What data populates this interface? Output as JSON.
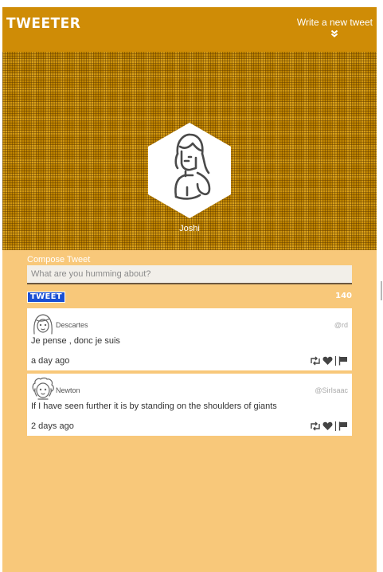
{
  "navbar": {
    "brand": "TWEETER",
    "write_new": "Write a new tweet"
  },
  "profile": {
    "name": "Joshi"
  },
  "compose": {
    "label": "Compose Tweet",
    "placeholder": "What are you humming about?",
    "button_label": "TWEET",
    "char_count": "140"
  },
  "tweets": [
    {
      "user": "Descartes",
      "handle": "@rd",
      "text": "Je pense , donc je suis",
      "time": "a day ago"
    },
    {
      "user": "Newton",
      "handle": "@SirIsaac",
      "text": "If I have seen further it is by standing on the shoulders of giants",
      "time": "2 days ago"
    }
  ],
  "colors": {
    "navbar": "#cf8c06",
    "page_background": "#f8c87a",
    "tweet_button": "#1a4fd3"
  }
}
